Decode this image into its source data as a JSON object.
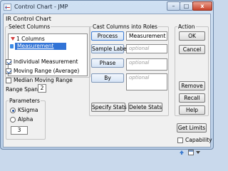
{
  "window": {
    "title": "Control Chart - JMP",
    "buttons": {
      "minimize": "–",
      "maximize": "□",
      "close": "x"
    }
  },
  "dialog": {
    "subtitle": "IR Control Chart",
    "select_columns": {
      "label": "Select Columns",
      "count": "1 Columns",
      "items": [
        "Measurement"
      ]
    },
    "chart_options": {
      "individual_measurement": {
        "label": "Individual Measurement",
        "checked": true
      },
      "moving_range_average": {
        "label": "Moving Range (Average)",
        "checked": true
      },
      "median_moving_range": {
        "label": "Median Moving Range",
        "checked": false
      },
      "range_span": {
        "label": "Range Span",
        "value": "2"
      }
    },
    "parameters": {
      "label": "Parameters",
      "options": [
        "KSigma",
        "Alpha"
      ],
      "selected": "KSigma",
      "value": "3"
    },
    "cast_roles": {
      "label": "Cast Columns into Roles",
      "roles": [
        {
          "button": "Process",
          "value": "Measurement"
        },
        {
          "button": "Sample Label",
          "value": "optional"
        },
        {
          "button": "Phase",
          "value": "optional"
        },
        {
          "button": "By",
          "value": "optional"
        }
      ],
      "specify_stats": "Specify Stats",
      "delete_stats": "Delete Stats"
    },
    "action": {
      "label": "Action",
      "ok": "OK",
      "cancel": "Cancel",
      "remove": "Remove",
      "recall": "Recall",
      "help": "Help"
    },
    "get_limits": "Get Limits",
    "capability": {
      "label": "Capability",
      "checked": false
    }
  }
}
